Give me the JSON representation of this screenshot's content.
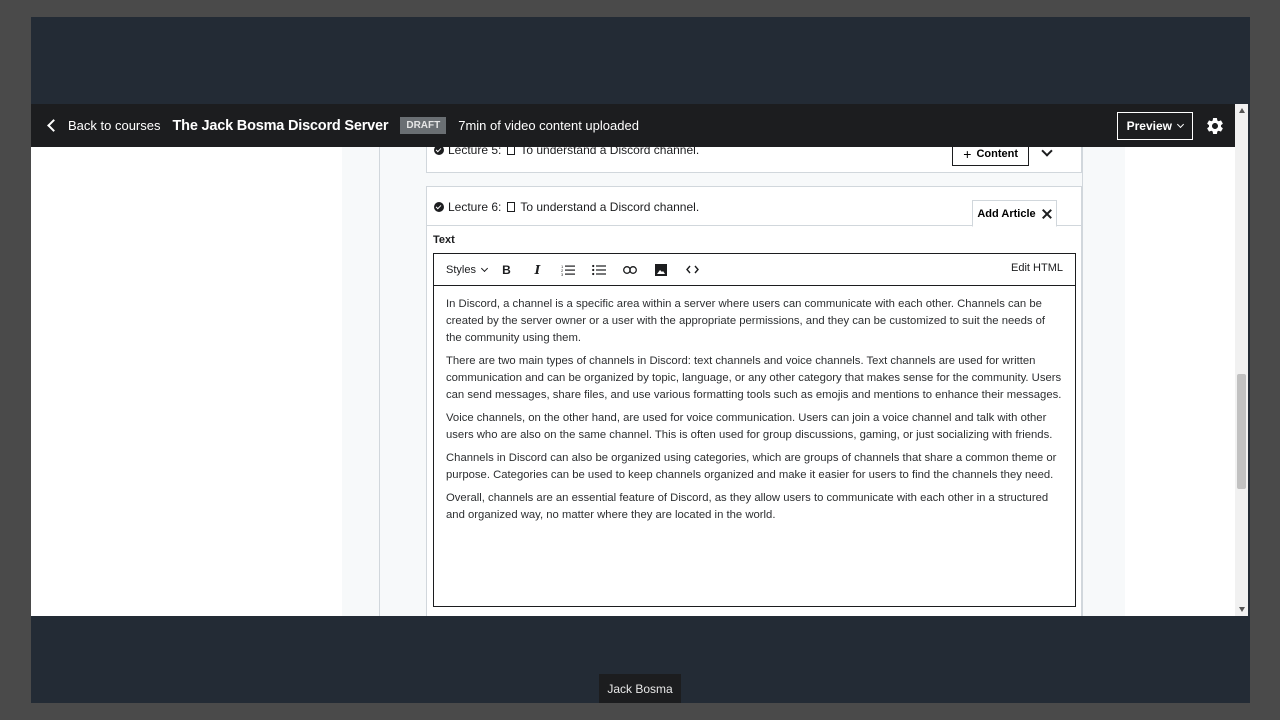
{
  "topbar": {
    "back_label": "Back to courses",
    "course_title": "The Jack Bosma Discord Server",
    "status_badge": "DRAFT",
    "upload_status": "7min of video content uploaded",
    "preview_label": "Preview"
  },
  "lectures": [
    {
      "label": "Lecture 5:",
      "title": "To understand a Discord channel.",
      "content_button": "Content"
    },
    {
      "label": "Lecture 6:",
      "title": "To understand a Discord channel.",
      "add_article_tab": "Add Article"
    }
  ],
  "editor": {
    "section_label": "Text",
    "styles_label": "Styles",
    "edit_html_label": "Edit HTML",
    "paragraphs": [
      "In Discord, a channel is a specific area within a server where users can communicate with each other. Channels can be created by the server owner or a user with the appropriate permissions, and they can be customized to suit the needs of the community using them.",
      "There are two main types of channels in Discord: text channels and voice channels. Text channels are used for written communication and can be organized by topic, language, or any other category that makes sense for the community. Users can send messages, share files, and use various formatting tools such as emojis and mentions to enhance their messages.",
      "Voice channels, on the other hand, are used for voice communication. Users can join a voice channel and talk with other users who are also on the same channel. This is often used for group discussions, gaming, or just socializing with friends.",
      "Channels in Discord can also be organized using categories, which are groups of channels that share a common theme or purpose. Categories can be used to keep channels organized and make it easier for users to find the channels they need.",
      "Overall, channels are an essential feature of Discord, as they allow users to communicate with each other in a structured and organized way, no matter where they are located in the world."
    ]
  },
  "video_caption": "Jack Bosma",
  "colors": {
    "topbar": "#1c1d1f",
    "frame": "#232b35",
    "outer": "#4a4a4a"
  }
}
